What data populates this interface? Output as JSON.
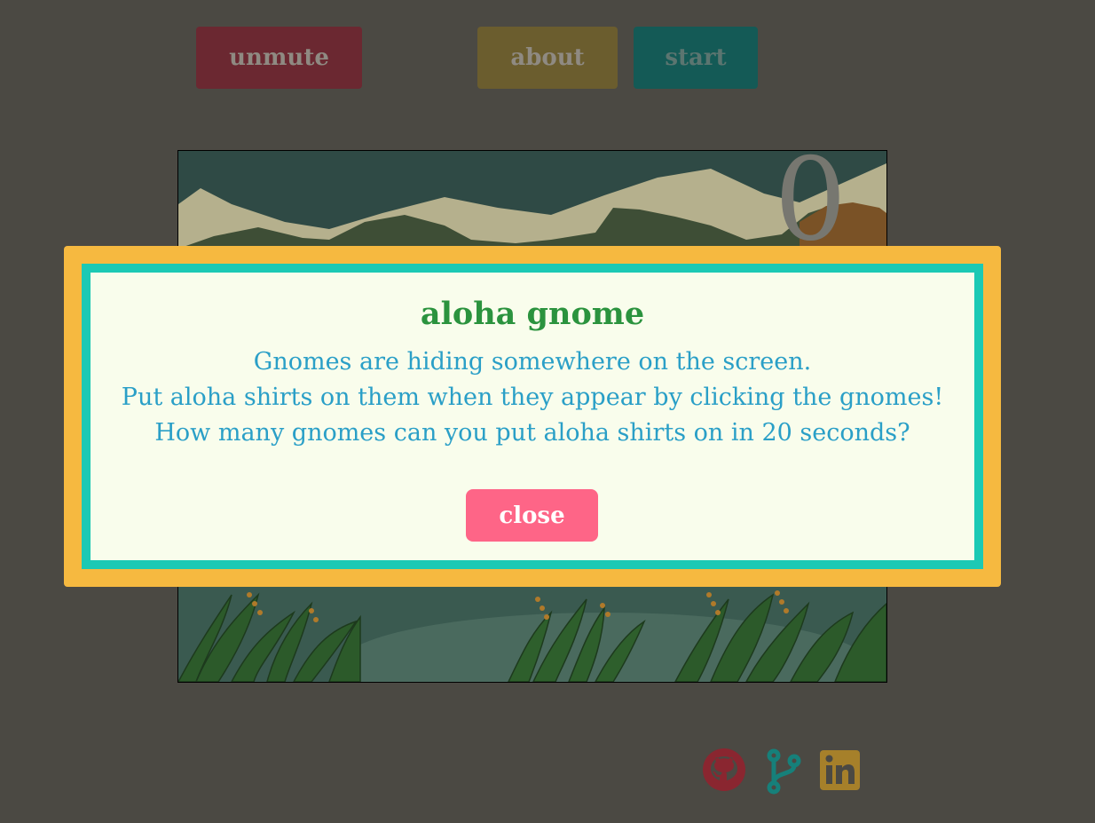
{
  "toolbar": {
    "unmute_label": "unmute",
    "about_label": "about",
    "start_label": "start"
  },
  "game": {
    "score": "0"
  },
  "modal": {
    "title": "aloha gnome",
    "lines": [
      "Gnomes are hiding somewhere on the screen.",
      "Put aloha shirts on them when they appear by clicking the gnomes!",
      "How many gnomes can you put aloha shirts on in 20 seconds?"
    ],
    "close_label": "close"
  },
  "footer": {
    "icons": [
      "github-icon",
      "git-branch-icon",
      "linkedin-icon"
    ]
  },
  "colors": {
    "background": "#4b4943",
    "modal_border_outer": "#f6b940",
    "modal_border_inner": "#1cc9b4",
    "modal_title": "#2b933e",
    "modal_text": "#2a9fc7",
    "close_button": "#fe6587",
    "github": "#8a2630",
    "git": "#16807a",
    "linkedin": "#a6802a"
  }
}
